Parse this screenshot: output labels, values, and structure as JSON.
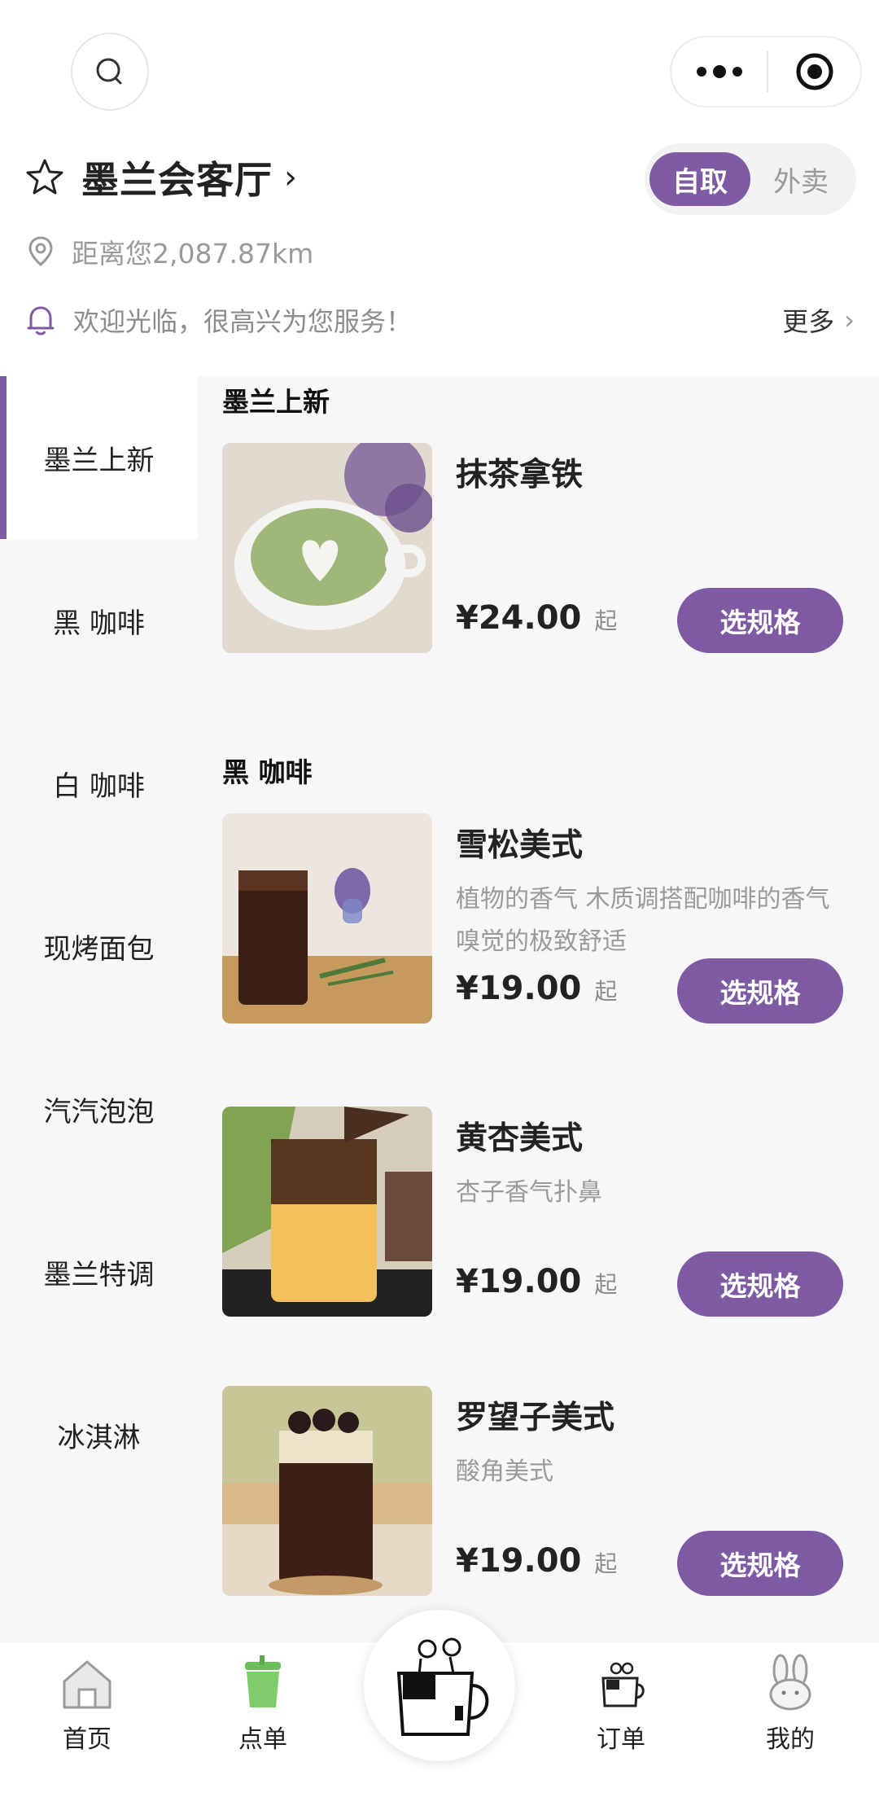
{
  "header": {
    "store_name": "墨兰会客厅",
    "store_arrow": "›",
    "mode_pickup": "自取",
    "mode_delivery": "外卖",
    "distance": "距离您2,087.87km",
    "notice": "欢迎光临，很高兴为您服务！",
    "more": "更多",
    "more_arrow": "›"
  },
  "colors": {
    "accent": "#7d5aa1",
    "sidebar_bg": "#f7f7f8",
    "content_bg": "#f7f6f8"
  },
  "sidebar": {
    "items": [
      {
        "label": "墨兰上新"
      },
      {
        "label": "黑 咖啡"
      },
      {
        "label": "白 咖啡"
      },
      {
        "label": "现烤面包"
      },
      {
        "label": "汽汽泡泡"
      },
      {
        "label": "墨兰特调"
      },
      {
        "label": "冰淇淋"
      }
    ]
  },
  "sections": [
    {
      "title": "墨兰上新",
      "items": [
        {
          "name": "抹茶拿铁",
          "desc": "",
          "price": "¥24.00",
          "from": "起",
          "button": "选规格"
        }
      ]
    },
    {
      "title": "黑 咖啡",
      "items": [
        {
          "name": "雪松美式",
          "desc": "植物的香气 木质调搭配咖啡的香气 嗅觉的极致舒适",
          "price": "¥19.00",
          "from": "起",
          "button": "选规格"
        },
        {
          "name": "黄杏美式",
          "desc": "杏子香气扑鼻",
          "price": "¥19.00",
          "from": "起",
          "button": "选规格"
        },
        {
          "name": "罗望子美式",
          "desc": "酸角美式",
          "price": "¥19.00",
          "from": "起",
          "button": "选规格"
        }
      ]
    }
  ],
  "tabbar": {
    "home": "首页",
    "order": "点单",
    "orders": "订单",
    "mine": "我的"
  },
  "icons": {
    "search": "search-icon",
    "more": "more-dots-icon",
    "target": "target-icon",
    "star": "star-icon",
    "location": "location-pin-icon",
    "bell": "bell-icon"
  }
}
